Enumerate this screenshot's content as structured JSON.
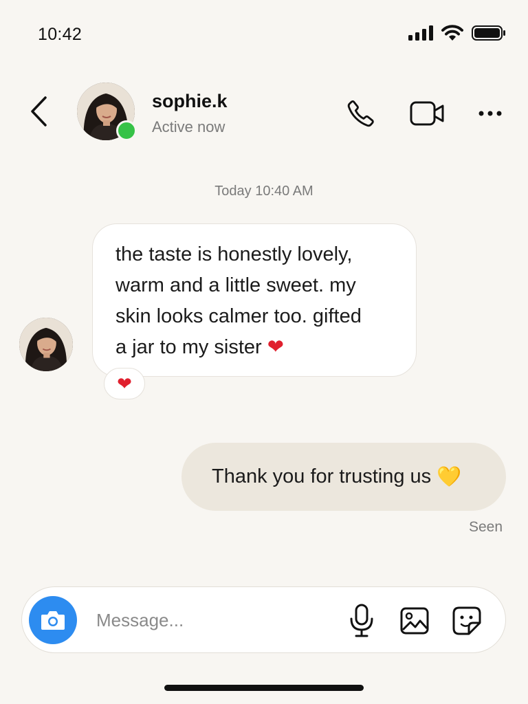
{
  "status_bar": {
    "time": "10:42",
    "icons": [
      "cellular-signal-icon",
      "wifi-icon",
      "battery-icon"
    ]
  },
  "header": {
    "username": "sophie.k",
    "presence": "Active now",
    "online": true,
    "actions": [
      "back-icon",
      "phone-icon",
      "video-camera-icon",
      "more-icon"
    ]
  },
  "conversation": {
    "timestamp": "Today 10:40 AM",
    "messages": [
      {
        "direction": "incoming",
        "lines": [
          "the taste is honestly lovely,",
          "warm and a little sweet. my",
          "skin looks calmer too. gifted",
          "a jar to my sister"
        ],
        "emoji": "❤",
        "reaction": "❤"
      },
      {
        "direction": "outgoing",
        "text": "Thank you for trusting us",
        "emoji": "💛"
      }
    ],
    "read_receipt": "Seen"
  },
  "composer": {
    "placeholder": "Message...",
    "value": "",
    "actions": [
      "camera-icon",
      "microphone-icon",
      "image-icon",
      "sticker-icon"
    ]
  },
  "colors": {
    "background": "#f8f6f2",
    "online": "#36c247",
    "camera_button": "#2d8cf0",
    "outgoing_bubble": "#ece7dd",
    "incoming_bubble": "#ffffff",
    "muted_text": "#7a7a7a"
  }
}
